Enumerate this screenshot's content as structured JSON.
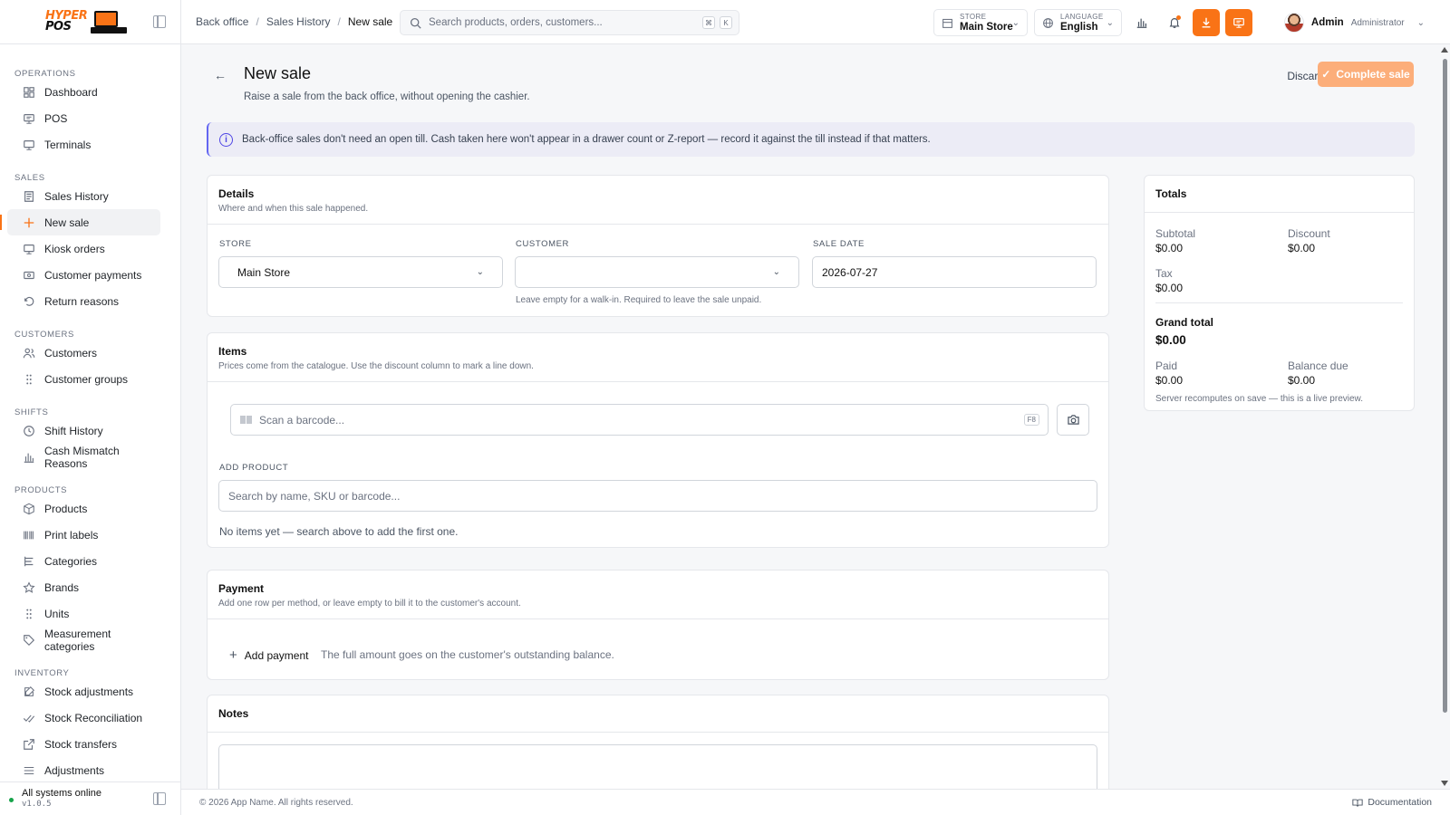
{
  "brand": {
    "line1": "HYPER",
    "line2": "POS"
  },
  "sidebar": {
    "sections": [
      {
        "title": "OPERATIONS",
        "items": [
          {
            "label": "Dashboard",
            "icon": "dashboard-icon"
          },
          {
            "label": "POS",
            "icon": "pos-icon"
          },
          {
            "label": "Terminals",
            "icon": "terminal-icon"
          }
        ]
      },
      {
        "title": "SALES",
        "items": [
          {
            "label": "Sales History",
            "icon": "receipt-icon"
          },
          {
            "label": "New sale",
            "icon": "plus-icon",
            "active": true
          },
          {
            "label": "Kiosk orders",
            "icon": "kiosk-icon"
          },
          {
            "label": "Customer payments",
            "icon": "wallet-icon"
          },
          {
            "label": "Return reasons",
            "icon": "undo-icon"
          }
        ]
      },
      {
        "title": "CUSTOMERS",
        "items": [
          {
            "label": "Customers",
            "icon": "users-icon"
          },
          {
            "label": "Customer groups",
            "icon": "grip-icon"
          }
        ]
      },
      {
        "title": "SHIFTS",
        "items": [
          {
            "label": "Shift History",
            "icon": "clock-icon"
          },
          {
            "label": "Cash Mismatch Reasons",
            "icon": "bar-chart-icon"
          }
        ]
      },
      {
        "title": "PRODUCTS",
        "items": [
          {
            "label": "Products",
            "icon": "box-icon"
          },
          {
            "label": "Print labels",
            "icon": "barcode-icon"
          },
          {
            "label": "Categories",
            "icon": "list-tree-icon"
          },
          {
            "label": "Brands",
            "icon": "star-icon"
          },
          {
            "label": "Units",
            "icon": "grip-icon"
          },
          {
            "label": "Measurement categories",
            "icon": "tag-icon"
          }
        ]
      },
      {
        "title": "INVENTORY",
        "items": [
          {
            "label": "Stock adjustments",
            "icon": "edit-icon"
          },
          {
            "label": "Stock Reconciliation",
            "icon": "check-check-icon"
          },
          {
            "label": "Stock transfers",
            "icon": "external-link-icon"
          },
          {
            "label": "Adjustments",
            "icon": "sliders-icon"
          }
        ]
      }
    ],
    "footer": {
      "status": "All systems online",
      "version": "v1.0.5"
    }
  },
  "topbar": {
    "breadcrumb": [
      "Back office",
      "Sales History",
      "New sale"
    ],
    "search_placeholder": "Search products, orders, customers...",
    "kbd": [
      "⌘",
      "K"
    ],
    "store": {
      "label": "STORE",
      "value": "Main Store"
    },
    "language": {
      "label": "LANGUAGE",
      "value": "English"
    },
    "user": {
      "name": "Admin",
      "role": "Administrator"
    }
  },
  "page": {
    "title": "New sale",
    "subtitle": "Raise a sale from the back office, without opening the cashier.",
    "discard": "Discard",
    "complete": "Complete sale",
    "alert": "Back-office sales don't need an open till. Cash taken here won't appear in a drawer count or Z-report — record it against the till instead if that matters."
  },
  "details": {
    "title": "Details",
    "subtitle": "Where and when this sale happened.",
    "store_label": "STORE",
    "store_value": "Main Store",
    "customer_label": "CUSTOMER",
    "customer_value": "",
    "customer_hint": "Leave empty for a walk-in. Required to leave the sale unpaid.",
    "date_label": "SALE DATE",
    "date_value": "2026-07-27"
  },
  "items": {
    "title": "Items",
    "subtitle": "Prices come from the catalogue. Use the discount column to mark a line down.",
    "barcode_placeholder": "Scan a barcode...",
    "barcode_key": "F8",
    "add_product_label": "ADD PRODUCT",
    "add_product_placeholder": "Search by name, SKU or barcode...",
    "empty": "No items yet — search above to add the first one."
  },
  "payment": {
    "title": "Payment",
    "subtitle": "Add one row per method, or leave empty to bill it to the customer's account.",
    "add_label": "Add payment",
    "note": "The full amount goes on the customer's outstanding balance."
  },
  "notes": {
    "title": "Notes"
  },
  "totals": {
    "title": "Totals",
    "subtotal_label": "Subtotal",
    "subtotal": "$0.00",
    "discount_label": "Discount",
    "discount": "$0.00",
    "tax_label": "Tax",
    "tax": "$0.00",
    "grand_label": "Grand total",
    "grand": "$0.00",
    "paid_label": "Paid",
    "paid": "$0.00",
    "balance_label": "Balance due",
    "balance": "$0.00",
    "note": "Server recomputes on save — this is a live preview."
  },
  "footer": {
    "copyright": "© 2026 App Name. All rights reserved.",
    "docs": "Documentation"
  },
  "colors": {
    "accent": "#f97316",
    "alert_border": "#6366f1",
    "online": "#16a34a"
  }
}
